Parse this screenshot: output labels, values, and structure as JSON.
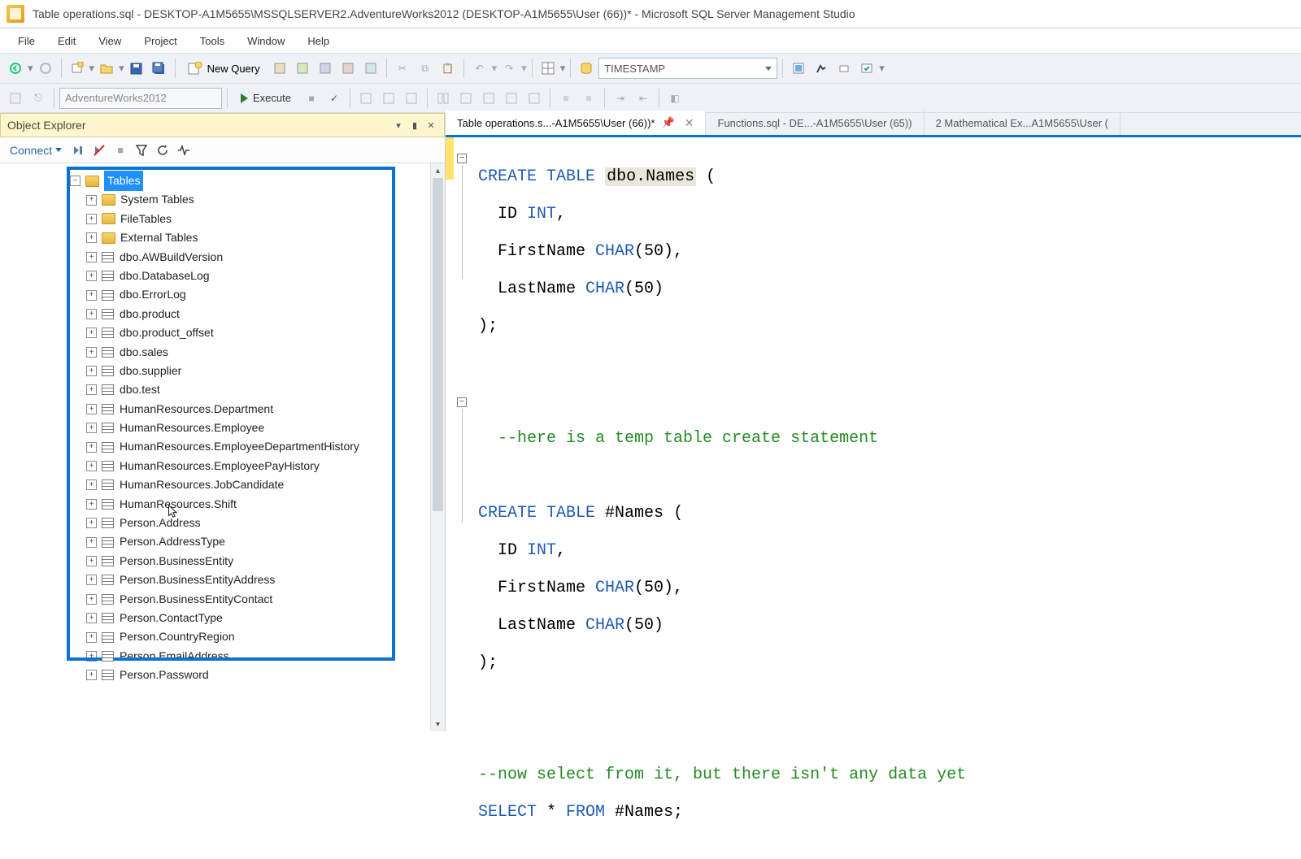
{
  "title": "Table operations.sql - DESKTOP-A1M5655\\MSSQLSERVER2.AdventureWorks2012 (DESKTOP-A1M5655\\User (66))* - Microsoft SQL Server Management Studio",
  "menu": {
    "file": "File",
    "edit": "Edit",
    "view": "View",
    "project": "Project",
    "tools": "Tools",
    "window": "Window",
    "help": "Help"
  },
  "toolbar": {
    "newquery": "New Query",
    "typecombo": "TIMESTAMP"
  },
  "toolbar2": {
    "db": "AdventureWorks2012",
    "execute": "Execute"
  },
  "explorer": {
    "title": "Object Explorer",
    "connect": "Connect",
    "root": "Tables",
    "folders": [
      "System Tables",
      "FileTables",
      "External Tables"
    ],
    "tables": [
      "dbo.AWBuildVersion",
      "dbo.DatabaseLog",
      "dbo.ErrorLog",
      "dbo.product",
      "dbo.product_offset",
      "dbo.sales",
      "dbo.supplier",
      "dbo.test",
      "HumanResources.Department",
      "HumanResources.Employee",
      "HumanResources.EmployeeDepartmentHistory",
      "HumanResources.EmployeePayHistory",
      "HumanResources.JobCandidate",
      "HumanResources.Shift",
      "Person.Address",
      "Person.AddressType",
      "Person.BusinessEntity",
      "Person.BusinessEntityAddress",
      "Person.BusinessEntityContact",
      "Person.ContactType",
      "Person.CountryRegion",
      "Person.EmailAddress",
      "Person.Password"
    ]
  },
  "tabs": {
    "t1": "Table operations.s...-A1M5655\\User (66))*",
    "t2": "Functions.sql - DE...-A1M5655\\User (65))",
    "t3": "2 Mathematical Ex...A1M5655\\User ("
  },
  "code": {
    "l1a": "CREATE",
    "l1b": "TABLE",
    "l1c": "dbo.Names",
    "l1d": " (",
    "l2a": "  ID ",
    "l2b": "INT",
    "l2c": ",",
    "l3a": "  FirstName ",
    "l3b": "CHAR",
    "l3c": "(50),",
    "l4a": "  LastName ",
    "l4b": "CHAR",
    "l4c": "(50)",
    "l5": ");",
    "c1": "  --here is a temp table create statement",
    "l6a": "CREATE",
    "l6b": "TABLE",
    "l6c": " #Names (",
    "l7a": "  ID ",
    "l7b": "INT",
    "l7c": ",",
    "l8a": "  FirstName ",
    "l8b": "CHAR",
    "l8c": "(50),",
    "l9a": "  LastName ",
    "l9b": "CHAR",
    "l9c": "(50)",
    "l10": ");",
    "c2": "--now select from it, but there isn't any data yet",
    "l11a": "SELECT",
    "l11b": " * ",
    "l11c": "FROM",
    "l11d": " #Names;"
  }
}
